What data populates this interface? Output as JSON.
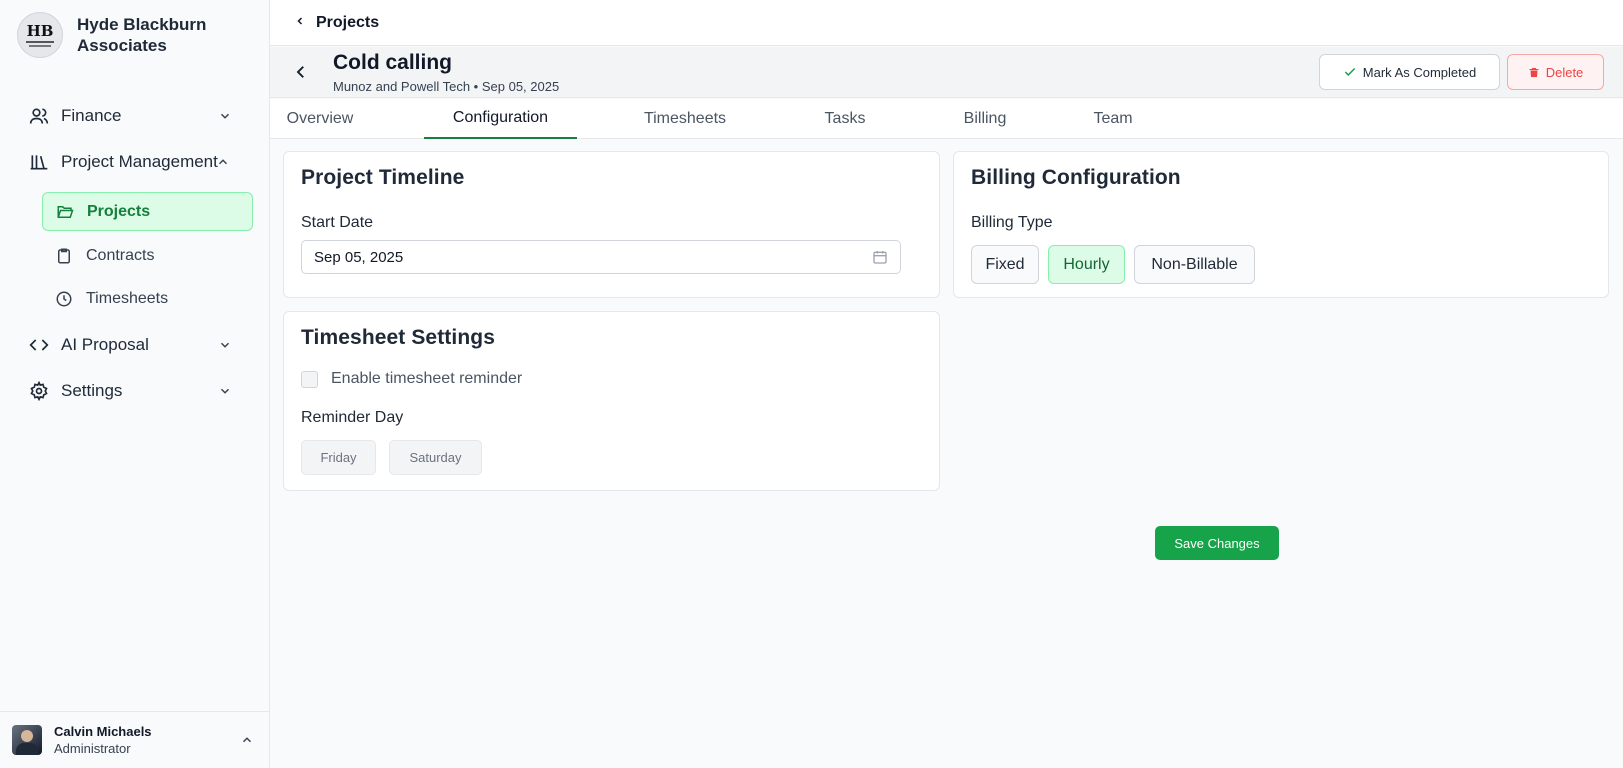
{
  "brand": {
    "name": "Hyde Blackburn Associates",
    "logo_monogram": "HB"
  },
  "nav": {
    "finance": "Finance",
    "project_management": "Project Management",
    "sub": {
      "projects": "Projects",
      "contracts": "Contracts",
      "timesheets": "Timesheets"
    },
    "ai_proposal": "AI Proposal",
    "settings": "Settings"
  },
  "user": {
    "name": "Calvin Michaels",
    "role": "Administrator"
  },
  "topbar": {
    "crumb": "Projects"
  },
  "project": {
    "title": "Cold calling",
    "subtitle": "Munoz and Powell Tech • Sep 05, 2025"
  },
  "actions": {
    "complete": "Mark As Completed",
    "delete": "Delete"
  },
  "tabs": [
    "Overview",
    "Configuration",
    "Timesheets",
    "Tasks",
    "Billing",
    "Team"
  ],
  "active_tab": "Configuration",
  "timeline": {
    "title": "Project Timeline",
    "start_label": "Start Date",
    "start_value": "Sep 05, 2025"
  },
  "timesheet": {
    "title": "Timesheet Settings",
    "reminder_label": "Enable timesheet reminder",
    "reminder_enabled": false,
    "day_label": "Reminder Day",
    "days": [
      "Friday",
      "Saturday"
    ]
  },
  "billing": {
    "title": "Billing Configuration",
    "type_label": "Billing Type",
    "options": [
      "Fixed",
      "Hourly",
      "Non-Billable"
    ],
    "selected": "Hourly"
  },
  "save": "Save Changes",
  "colors": {
    "accent": "#16a34a",
    "active_bg": "#dcfce7",
    "danger": "#ef4444"
  }
}
